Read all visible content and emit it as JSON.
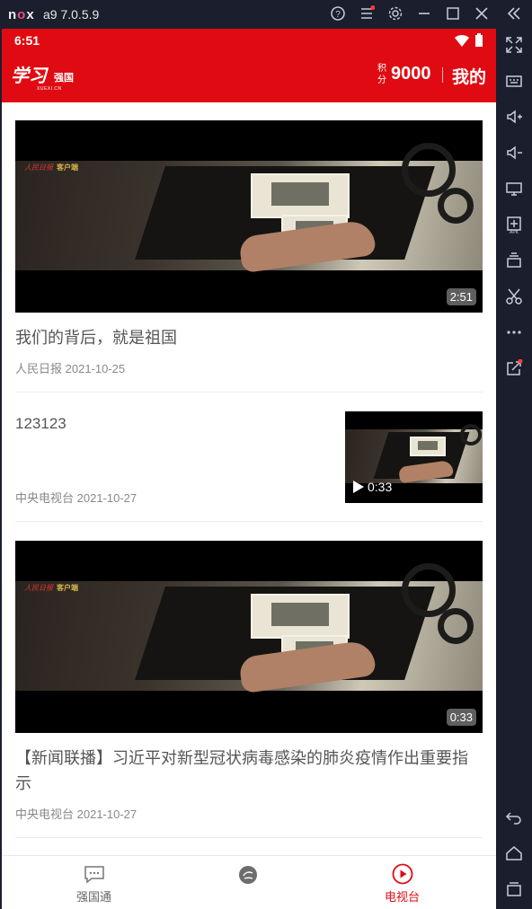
{
  "emulator": {
    "logo": "nox",
    "title": "a9 7.0.5.9",
    "controls": [
      "help-icon",
      "menu-icon",
      "settings-icon",
      "minimize-icon",
      "maximize-icon",
      "close-icon",
      "collapse-icon"
    ],
    "side_tools": [
      "fullscreen-icon",
      "keyboard-icon",
      "volume-up-icon",
      "volume-down-icon",
      "screen-icon",
      "apk-install-icon",
      "multi-instance-icon",
      "scissors-icon",
      "more-icon",
      "share-icon",
      "back-icon",
      "home-icon",
      "recent-apps-icon"
    ]
  },
  "status_bar": {
    "time": "6:51"
  },
  "app_bar": {
    "logo_text": "学习",
    "logo_sub": "强国",
    "logo_tiny": "XUEXI.CN",
    "score_label": "积分",
    "score": "9000",
    "mine_label": "我的"
  },
  "feed": [
    {
      "type": "large",
      "title": "我们的背后，就是祖国",
      "source": "人民日报",
      "date": "2021-10-25",
      "duration": "2:51",
      "watermark": "人民日报",
      "watermark_tag": "客户端"
    },
    {
      "type": "small",
      "title": "123123",
      "source": "中央电视台",
      "date": "2021-10-27",
      "duration": "0:33"
    },
    {
      "type": "large",
      "title": "【新闻联播】习近平对新型冠状病毒感染的肺炎疫情作出重要指示",
      "source": "中央电视台",
      "date": "2021-10-27",
      "duration": "0:33",
      "watermark": "人民日报",
      "watermark_tag": "客户端"
    }
  ],
  "tabs": [
    {
      "label": "强国通",
      "icon": "chat-icon",
      "active": false
    },
    {
      "label": "",
      "icon": "xuexi-logo-icon",
      "active": false
    },
    {
      "label": "电视台",
      "icon": "play-circle-icon",
      "active": true
    }
  ],
  "colors": {
    "brand_red": "#e00b12",
    "emulator_bg": "#1b1e2c"
  }
}
